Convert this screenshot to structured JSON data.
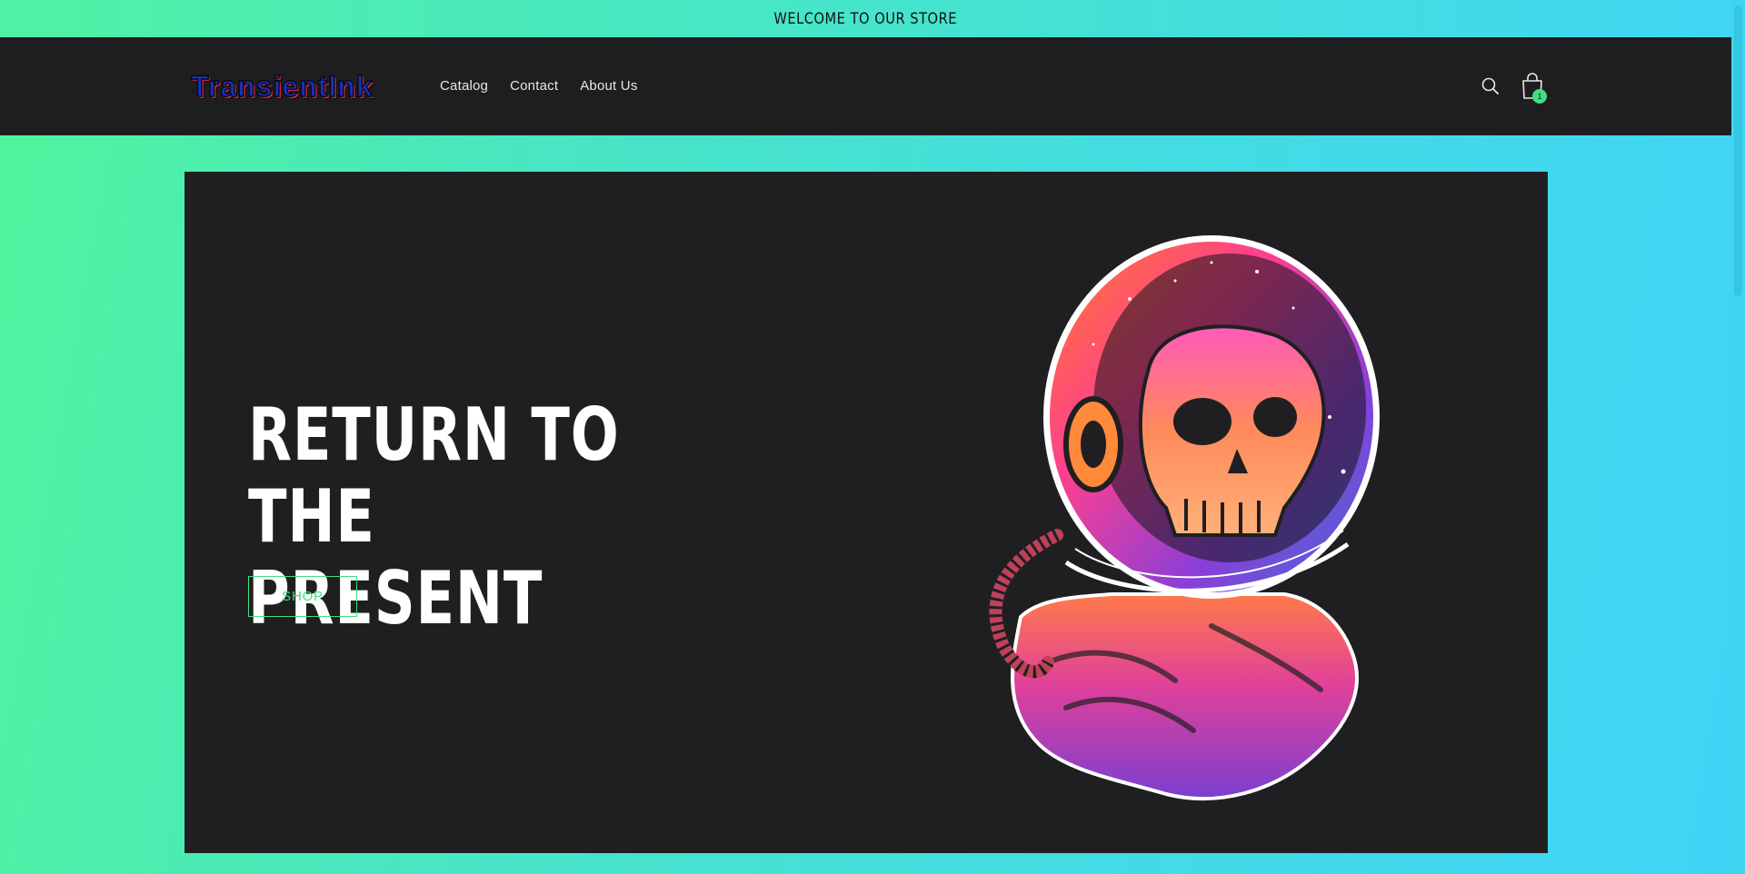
{
  "announcement": {
    "text": "WELCOME TO OUR STORE"
  },
  "header": {
    "logo_text": "TransientInk",
    "nav": [
      {
        "label": "Catalog"
      },
      {
        "label": "Contact"
      },
      {
        "label": "About Us"
      }
    ],
    "search_icon": "search-icon",
    "cart_icon": "shopping-bag-icon",
    "cart_count": "1"
  },
  "hero": {
    "heading": "RETURN TO THE PRESENT",
    "button_label": "SHOP",
    "image": "astronaut-skull-illustration"
  },
  "colors": {
    "header_bg": "#1e1e21",
    "hero_bg": "#1f1f22",
    "accent": "#3fe07f",
    "gradient_start": "#4ff59c",
    "gradient_end": "#3fd4f7"
  }
}
